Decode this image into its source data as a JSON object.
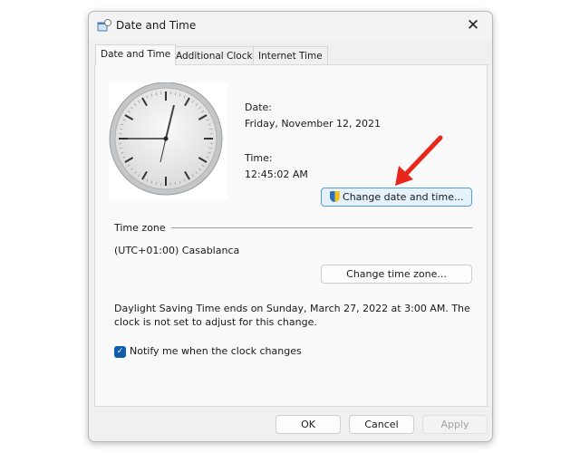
{
  "window": {
    "title": "Date and Time",
    "close_icon": "close-icon"
  },
  "tabs": [
    {
      "label": "Date and Time",
      "active": true
    },
    {
      "label": "Additional Clocks"
    },
    {
      "label": "Internet Time"
    }
  ],
  "datetime": {
    "date_label": "Date:",
    "date_value": "Friday, November 12, 2021",
    "time_label": "Time:",
    "time_value": "12:45:02 AM",
    "change_button": "Change date and time..."
  },
  "timezone": {
    "section_label": "Time zone",
    "value": "(UTC+01:00) Casablanca",
    "change_button": "Change time zone..."
  },
  "dst": {
    "line1": "Daylight Saving Time ends on Sunday, March 27, 2022 at 3:00 AM. The",
    "line2": "clock is not set to adjust for this change."
  },
  "notify": {
    "label": "Notify me when the clock changes",
    "checked": true
  },
  "footer": {
    "ok": "OK",
    "cancel": "Cancel",
    "apply": "Apply"
  },
  "colors": {
    "accent": "#0f5dab",
    "annotation_arrow": "#e8261c"
  }
}
